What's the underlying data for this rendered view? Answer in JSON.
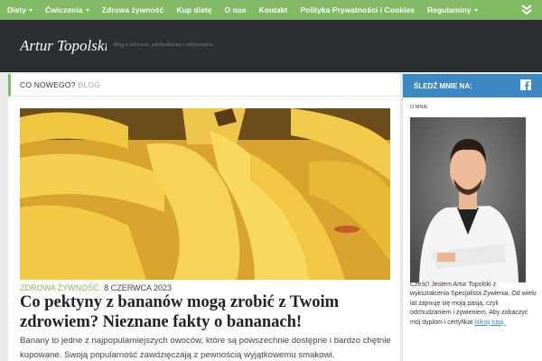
{
  "nav": {
    "items": [
      {
        "label": "Diety",
        "dropdown": true
      },
      {
        "label": "Ćwiczenia",
        "dropdown": true
      },
      {
        "label": "Zdrowa żywność",
        "dropdown": false
      },
      {
        "label": "Kup dietę",
        "dropdown": false
      },
      {
        "label": "O nas",
        "dropdown": false
      },
      {
        "label": "Kontakt",
        "dropdown": false
      },
      {
        "label": "Polityka Prywatności i Cookies",
        "dropdown": false
      },
      {
        "label": "Regulaminy",
        "dropdown": true
      }
    ],
    "toggle_icon": "double-chevron-down-icon",
    "color": "#82b965"
  },
  "header": {
    "logo": "Artur Topolski",
    "tagline": "Blog o zdrowiu, odchudzaniu i odżywianiu",
    "background": "#2b2e32"
  },
  "main": {
    "heading_part1": "Co nowego?",
    "heading_part2": "Blog",
    "post": {
      "category": "Zdrowa żywność",
      "date": "8 czerwca 2023",
      "title": "Co pektyny z bananów mogą zrobić z Twoim zdrowiem? Nieznane fakty o bananach!",
      "excerpt": "Banany to jedne z najpopularniejszych owoców, które są powszechnie dostępne i bardzo chętnie kupowane. Swoją popularność zawdzięczają z pewnością wyjątkowemu smakowi."
    }
  },
  "sidebar": {
    "follow_label": "Śledź mnie na:",
    "follow_color": "#3b88c3",
    "social_icon": "facebook-icon",
    "about_label": "O mnie",
    "bio_text": "Cześć! Jestem Artur Topolski z wykształcenia Specjalista Żywienia. Od wielu lat zajmuję się moją pasją, czyli odchudzaniem i żywieniem. Aby zobaczyć mój dyplom i certyfikat",
    "bio_link": "kliknij tutaj."
  }
}
